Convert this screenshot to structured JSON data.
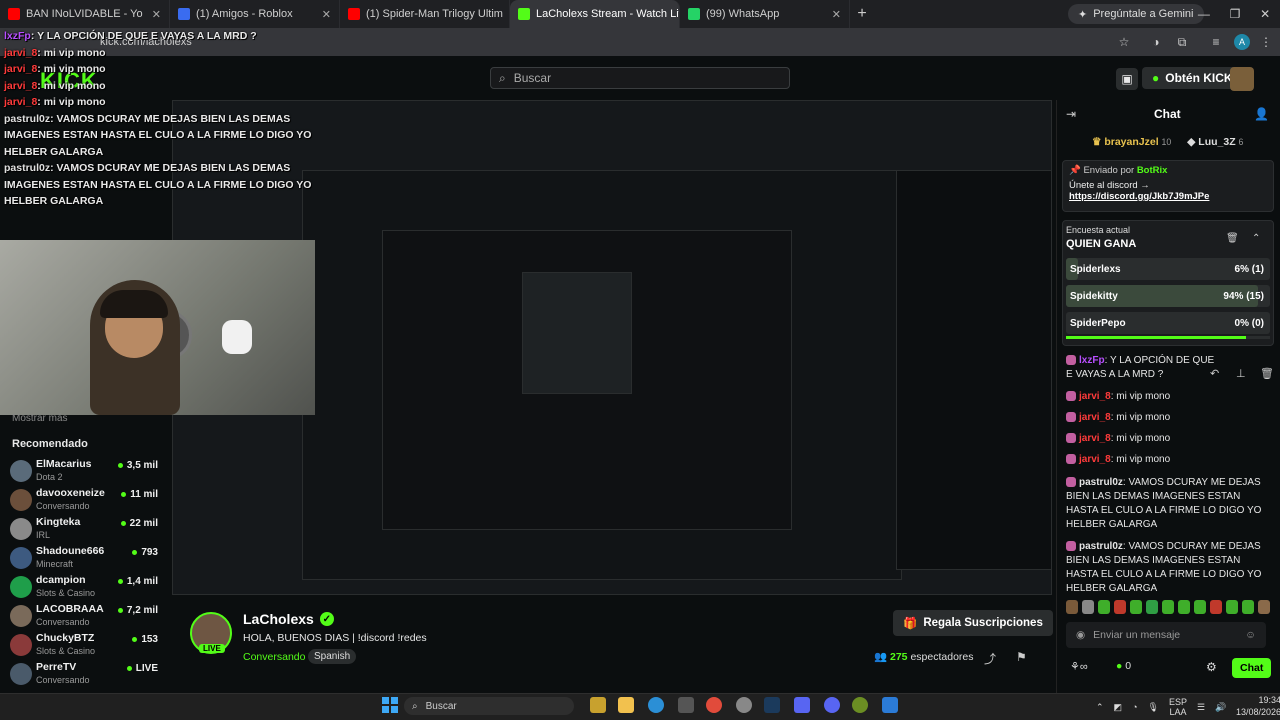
{
  "browser": {
    "tabs": [
      {
        "label": "BAN INoLVIDABLE - Yo",
        "color": "#ff0000"
      },
      {
        "label": "(1) Amigos - Roblox",
        "color": "#3a6cf0"
      },
      {
        "label": "(1) Spider-Man Trilogy Ultim",
        "color": "#ff0000"
      },
      {
        "label": "LaCholexs Stream - Watch Live",
        "color": "#53fc18"
      },
      {
        "label": "(99) WhatsApp",
        "color": "#25d366"
      }
    ],
    "gemini_label": "Pregúntale a Gemini",
    "url": "kick.com/lacholexs"
  },
  "header": {
    "logo": "KICK",
    "search_placeholder": "Buscar",
    "kicks_button": "Obtén KICKs"
  },
  "overlay_chat": [
    {
      "user": "lxzFp",
      "text": ": Y LA OPCIÓN DE QUE E VAYAS A LA MRD ?",
      "color": "a"
    },
    {
      "user": "jarvi_8",
      "text": ": mi vip mono",
      "color": "b"
    },
    {
      "user": "jarvi_8",
      "text": ": mi vip mono",
      "color": "b"
    },
    {
      "user": "jarvi_8",
      "text": ": mi vip mono",
      "color": "b"
    },
    {
      "user": "jarvi_8",
      "text": ": mi vip mono",
      "color": "b"
    },
    {
      "user": "pastrul0z",
      "text": ": VAMOS DCURAY ME DEJAS BIEN LAS DEMAS IMAGENES ESTAN HASTA EL CULO A LA FIRME LO DIGO YO HELBER GALARGA",
      "color": "c"
    },
    {
      "user": "pastrul0z",
      "text": ": VAMOS DCURAY ME DEJAS BIEN LAS DEMAS IMAGENES ESTAN HASTA EL CULO A LA FIRME LO DIGO YO HELBER GALARGA",
      "color": "c"
    }
  ],
  "sidebar": {
    "show_less": "Mostrar más",
    "recommended_title": "Recomendado",
    "items": [
      {
        "name": "ElMacarius",
        "category": "Dota 2",
        "viewers": "3,5 mil",
        "avatar": "#5a6b7a"
      },
      {
        "name": "davooxeneize",
        "category": "Conversando",
        "viewers": "11 mil",
        "avatar": "#6b4f3b"
      },
      {
        "name": "Kingteka",
        "category": "IRL",
        "viewers": "22 mil",
        "avatar": "#8a8a8a"
      },
      {
        "name": "Shadoune666",
        "category": "Minecraft",
        "viewers": "793",
        "avatar": "#3d5a80"
      },
      {
        "name": "dcampion",
        "category": "Slots & Casino",
        "viewers": "1,4 mil",
        "avatar": "#1f9e4a"
      },
      {
        "name": "LACOBRAAA",
        "category": "Conversando",
        "viewers": "7,2 mil",
        "avatar": "#7a6a5a"
      },
      {
        "name": "ChuckyBTZ",
        "category": "Slots & Casino",
        "viewers": "153",
        "avatar": "#8a3a3a"
      },
      {
        "name": "PerreTV",
        "category": "Conversando",
        "viewers": "LIVE",
        "avatar": "#4a5a6a"
      }
    ]
  },
  "channel": {
    "name": "LaCholexs",
    "live": "LIVE",
    "title": "HOLA, BUENOS DIAS | !discord !redes",
    "category": "Conversando",
    "language": "Spanish",
    "subscribe_button": "Regala Suscripciones",
    "viewers_count": "275",
    "viewers_label": "espectadores"
  },
  "chat": {
    "title": "Chat",
    "leaders": [
      {
        "name": "brayanJzel",
        "count": "10"
      },
      {
        "name": "Luu_3Z",
        "count": "6"
      }
    ],
    "pinned": {
      "by_label": "Enviado por",
      "bot": "BotRix",
      "message": "Únete al discord →",
      "link": "https://discord.gg/Jkb7J9mJPe"
    },
    "poll": {
      "label": "Encuesta actual",
      "question": "QUIEN GANA",
      "options": [
        {
          "name": "Spiderlexs",
          "result": "6% (1)",
          "share": 0.06
        },
        {
          "name": "Spidekitty",
          "result": "94% (15)",
          "share": 0.94
        },
        {
          "name": "SpiderPepo",
          "result": "0% (0)",
          "share": 0.0
        }
      ],
      "time_remaining": 0.88
    },
    "messages": [
      {
        "user": "lxzFp",
        "text": ": Y LA OPCIÓN DE QUE E VAYAS A LA MRD ?",
        "color": "#b84fff"
      },
      {
        "user": "jarvi_8",
        "text": ": mi vip mono",
        "color": "#ff3b3b"
      },
      {
        "user": "jarvi_8",
        "text": ": mi vip mono",
        "color": "#ff3b3b"
      },
      {
        "user": "jarvi_8",
        "text": ": mi vip mono",
        "color": "#ff3b3b"
      },
      {
        "user": "jarvi_8",
        "text": ": mi vip mono",
        "color": "#ff3b3b"
      },
      {
        "user": "pastrul0z",
        "text": ": VAMOS DCURAY ME DEJAS BIEN LAS DEMAS IMAGENES ESTAN HASTA EL CULO A LA FIRME LO DIGO YO HELBER GALARGA",
        "color": "#e6e6e6"
      },
      {
        "user": "pastrul0z",
        "text": ": VAMOS DCURAY ME DEJAS BIEN LAS DEMAS IMAGENES ESTAN HASTA EL CULO A LA FIRME LO DIGO YO HELBER GALARGA",
        "color": "#e6e6e6"
      }
    ],
    "input_placeholder": "Enviar un mensaje",
    "kicks_count": "0",
    "send_button": "Chat"
  },
  "taskbar": {
    "search_placeholder": "Buscar",
    "lang": "ESP",
    "lang2": "LAA",
    "time": "19:34",
    "date": "13/08/2026"
  }
}
